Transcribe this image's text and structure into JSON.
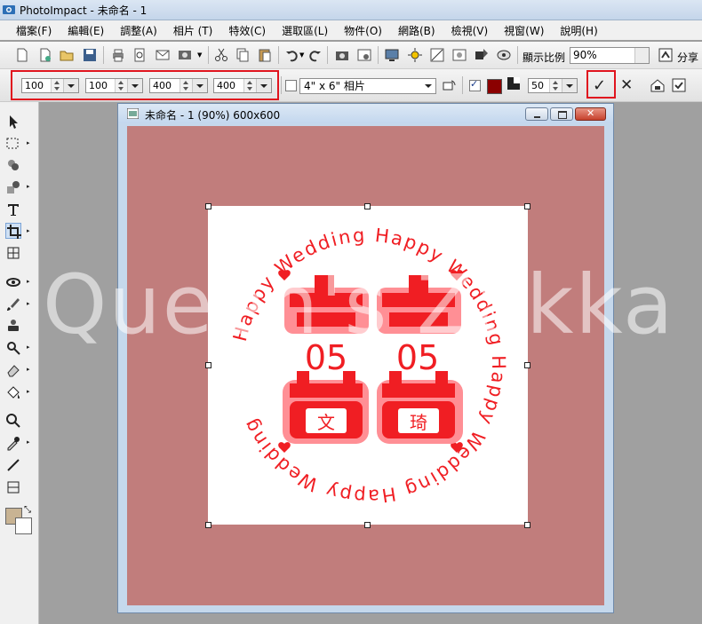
{
  "window": {
    "title": "PhotoImpact - 未命名 - 1"
  },
  "menu": [
    {
      "label": "檔案(F)"
    },
    {
      "label": "編輯(E)"
    },
    {
      "label": "調整(A)"
    },
    {
      "label": "相片 (T)"
    },
    {
      "label": "特效(C)"
    },
    {
      "label": "選取區(L)"
    },
    {
      "label": "物件(O)"
    },
    {
      "label": "網路(B)"
    },
    {
      "label": "檢視(V)"
    },
    {
      "label": "視窗(W)"
    },
    {
      "label": "說明(H)"
    }
  ],
  "toolbar1": {
    "zoom_label": "顯示比例",
    "zoom_value": "90%",
    "share_label": "分享"
  },
  "toolbar2": {
    "crop_x": "100",
    "crop_y": "100",
    "crop_w": "400",
    "crop_h": "400",
    "preset_size": "4\" x 6\" 相片",
    "opacity": "50",
    "colors": {
      "shade": "#8b0000",
      "highlight_border": "#e0141e"
    }
  },
  "document": {
    "title": "未命名 - 1 (90%) 600x600",
    "canvas_color": "#c17d7c"
  },
  "stamp": {
    "ring_text": "Happy Wedding Happy Wedding Happy Wedding Happy Wedding",
    "date_left": "05",
    "date_right": "05",
    "name_left": "文",
    "name_right": "琦",
    "color": "#f01e23"
  },
  "watermark": "Queen's Zakka",
  "tools": [
    {
      "icon": "pick-tool-icon"
    },
    {
      "icon": "selection-tool-icon"
    },
    {
      "icon": "paint-tool-icon"
    },
    {
      "icon": "clone-tool-icon"
    },
    {
      "icon": "text-tool-icon"
    },
    {
      "icon": "crop-tool-icon"
    },
    {
      "icon": "transform-tool-icon"
    },
    {
      "icon": "eye-tool-icon"
    },
    {
      "icon": "brush-tool-icon"
    },
    {
      "icon": "stamp-tool-icon"
    },
    {
      "icon": "retouch-tool-icon"
    },
    {
      "icon": "eraser-tool-icon"
    },
    {
      "icon": "fill-tool-icon"
    },
    {
      "icon": "zoom-tool-icon"
    },
    {
      "icon": "eyedropper-tool-icon"
    },
    {
      "icon": "line-tool-icon"
    },
    {
      "icon": "slice-tool-icon"
    }
  ]
}
